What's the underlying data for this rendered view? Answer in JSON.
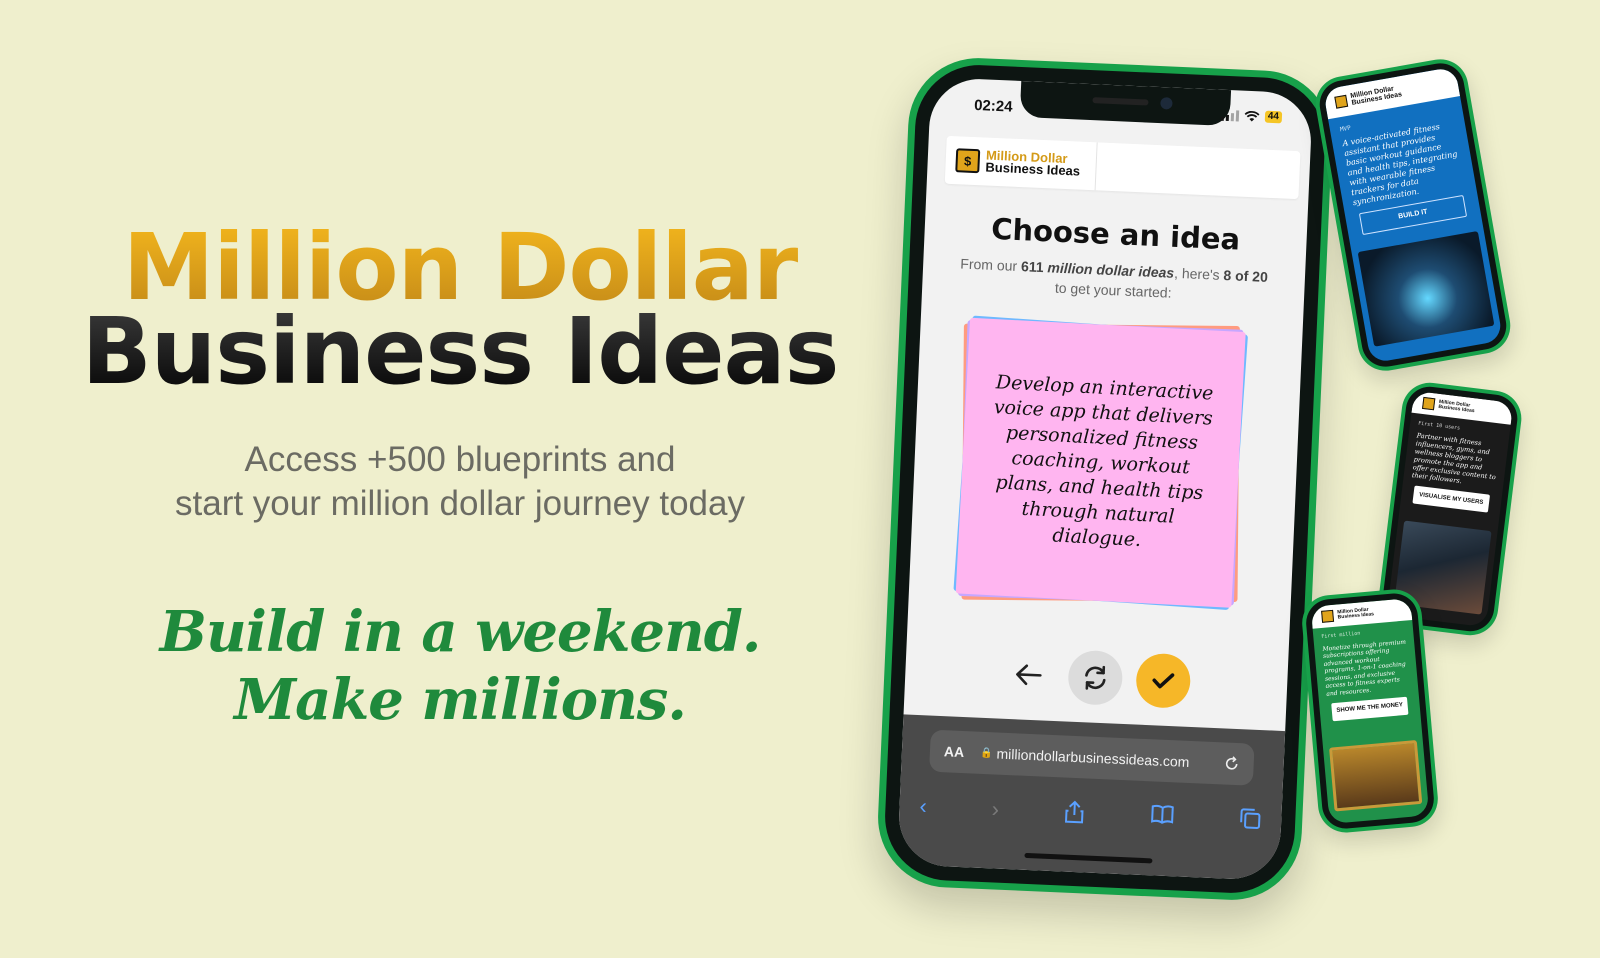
{
  "hero": {
    "title_line1": "Million Dollar",
    "title_line2": "Business Ideas",
    "subtitle_line1": "Access +500 blueprints and",
    "subtitle_line2": "start your million dollar journey today",
    "tagline_line1": "Build in a weekend.",
    "tagline_line2": "Make millions."
  },
  "phone": {
    "status_time": "02:24",
    "battery": "44",
    "logo_mark": "$",
    "logo_line1": "Million Dollar",
    "logo_line2": "Business Ideas",
    "page_title": "Choose an idea",
    "sub_from": "From our",
    "sub_count": "611",
    "sub_ideas": "million dollar ideas",
    "sub_heres": ", here's",
    "sub_position": "8 of 20",
    "sub_end": "to get your started:",
    "idea_text": "Develop an interactive voice app that delivers personalized fitness coaching, workout plans, and health tips through natural dialogue.",
    "browser": {
      "aa": "AA",
      "url": "milliondollarbusinessideas.com"
    }
  },
  "mini_phones": [
    {
      "label": "MVP",
      "text": "A voice-activated fitness assistant that provides basic workout guidance and health tips, integrating with wearable fitness trackers for data synchronization.",
      "button": "BUILD IT",
      "bg": "#1170c0"
    },
    {
      "label": "First 10 users",
      "text": "Partner with fitness influencers, gyms, and wellness bloggers to promote the app and offer exclusive content to their followers.",
      "button": "VISUALISE MY USERS",
      "bg": "#1b1b1b"
    },
    {
      "label": "First million",
      "text": "Monetize through premium subscriptions offering advanced workout programs, 1-on-1 coaching sessions, and exclusive access to fitness experts and resources.",
      "button": "SHOW ME THE MONEY",
      "bg": "#20914a"
    }
  ],
  "colors": {
    "background": "#efefcd",
    "gold": "#d9a21b",
    "green": "#1f8a3c",
    "card_pink": "#ffb5f0",
    "accept_yellow": "#f6b728"
  }
}
